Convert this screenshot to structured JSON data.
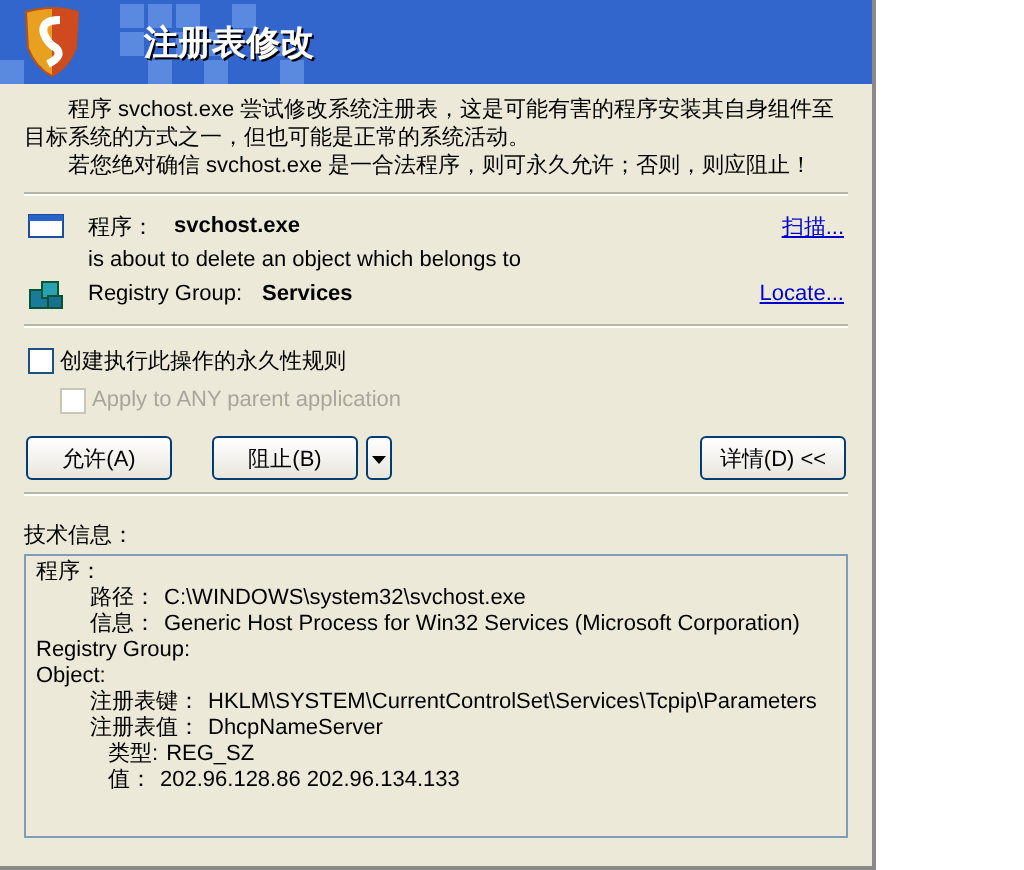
{
  "window": {
    "title": "注册表修改"
  },
  "message": [
    "程序 svchost.exe 尝试修改系统注册表，这是可能有害的程序安装其自身组件至目标系统的方式之一，但也可能是正常的系统活动。",
    "若您绝对确信 svchost.exe 是一合法程序，则可永久允许；否则，则应阻止！"
  ],
  "program": {
    "label": "程序：",
    "name": "svchost.exe",
    "link": "扫描..."
  },
  "action": "is about to delete an object which belongs to",
  "group": {
    "label": "Registry Group:",
    "name": "Services",
    "link": "Locate..."
  },
  "options": [
    {
      "label": "创建执行此操作的永久性规则",
      "checked": false,
      "disabled": false
    },
    {
      "label": "Apply to ANY parent application",
      "checked": false,
      "disabled": true
    }
  ],
  "buttons": {
    "allow": "允许(A)",
    "block": "阻止(B)",
    "details": "详情(D) <<"
  },
  "tech_info": {
    "title": "技术信息：",
    "lines": [
      {
        "label": "程序：",
        "children": [
          {
            "label": "路径：",
            "value": "C:\\WINDOWS\\system32\\svchost.exe"
          },
          {
            "label": "信息：",
            "value": "Generic Host Process for Win32 Services (Microsoft Corporation)"
          }
        ]
      },
      {
        "label": "Registry Group:"
      },
      {
        "label": "Object:",
        "children": [
          {
            "label": "注册表键：",
            "value": "HKLM\\SYSTEM\\CurrentControlSet\\Services\\Tcpip\\Parameters"
          },
          {
            "label": "注册表值：",
            "value": "DhcpNameServer",
            "children": [
              {
                "label": "类型:",
                "value": "REG_SZ"
              },
              {
                "label": "值：",
                "value": "202.96.128.86 202.96.134.133"
              }
            ]
          }
        ]
      }
    ]
  }
}
